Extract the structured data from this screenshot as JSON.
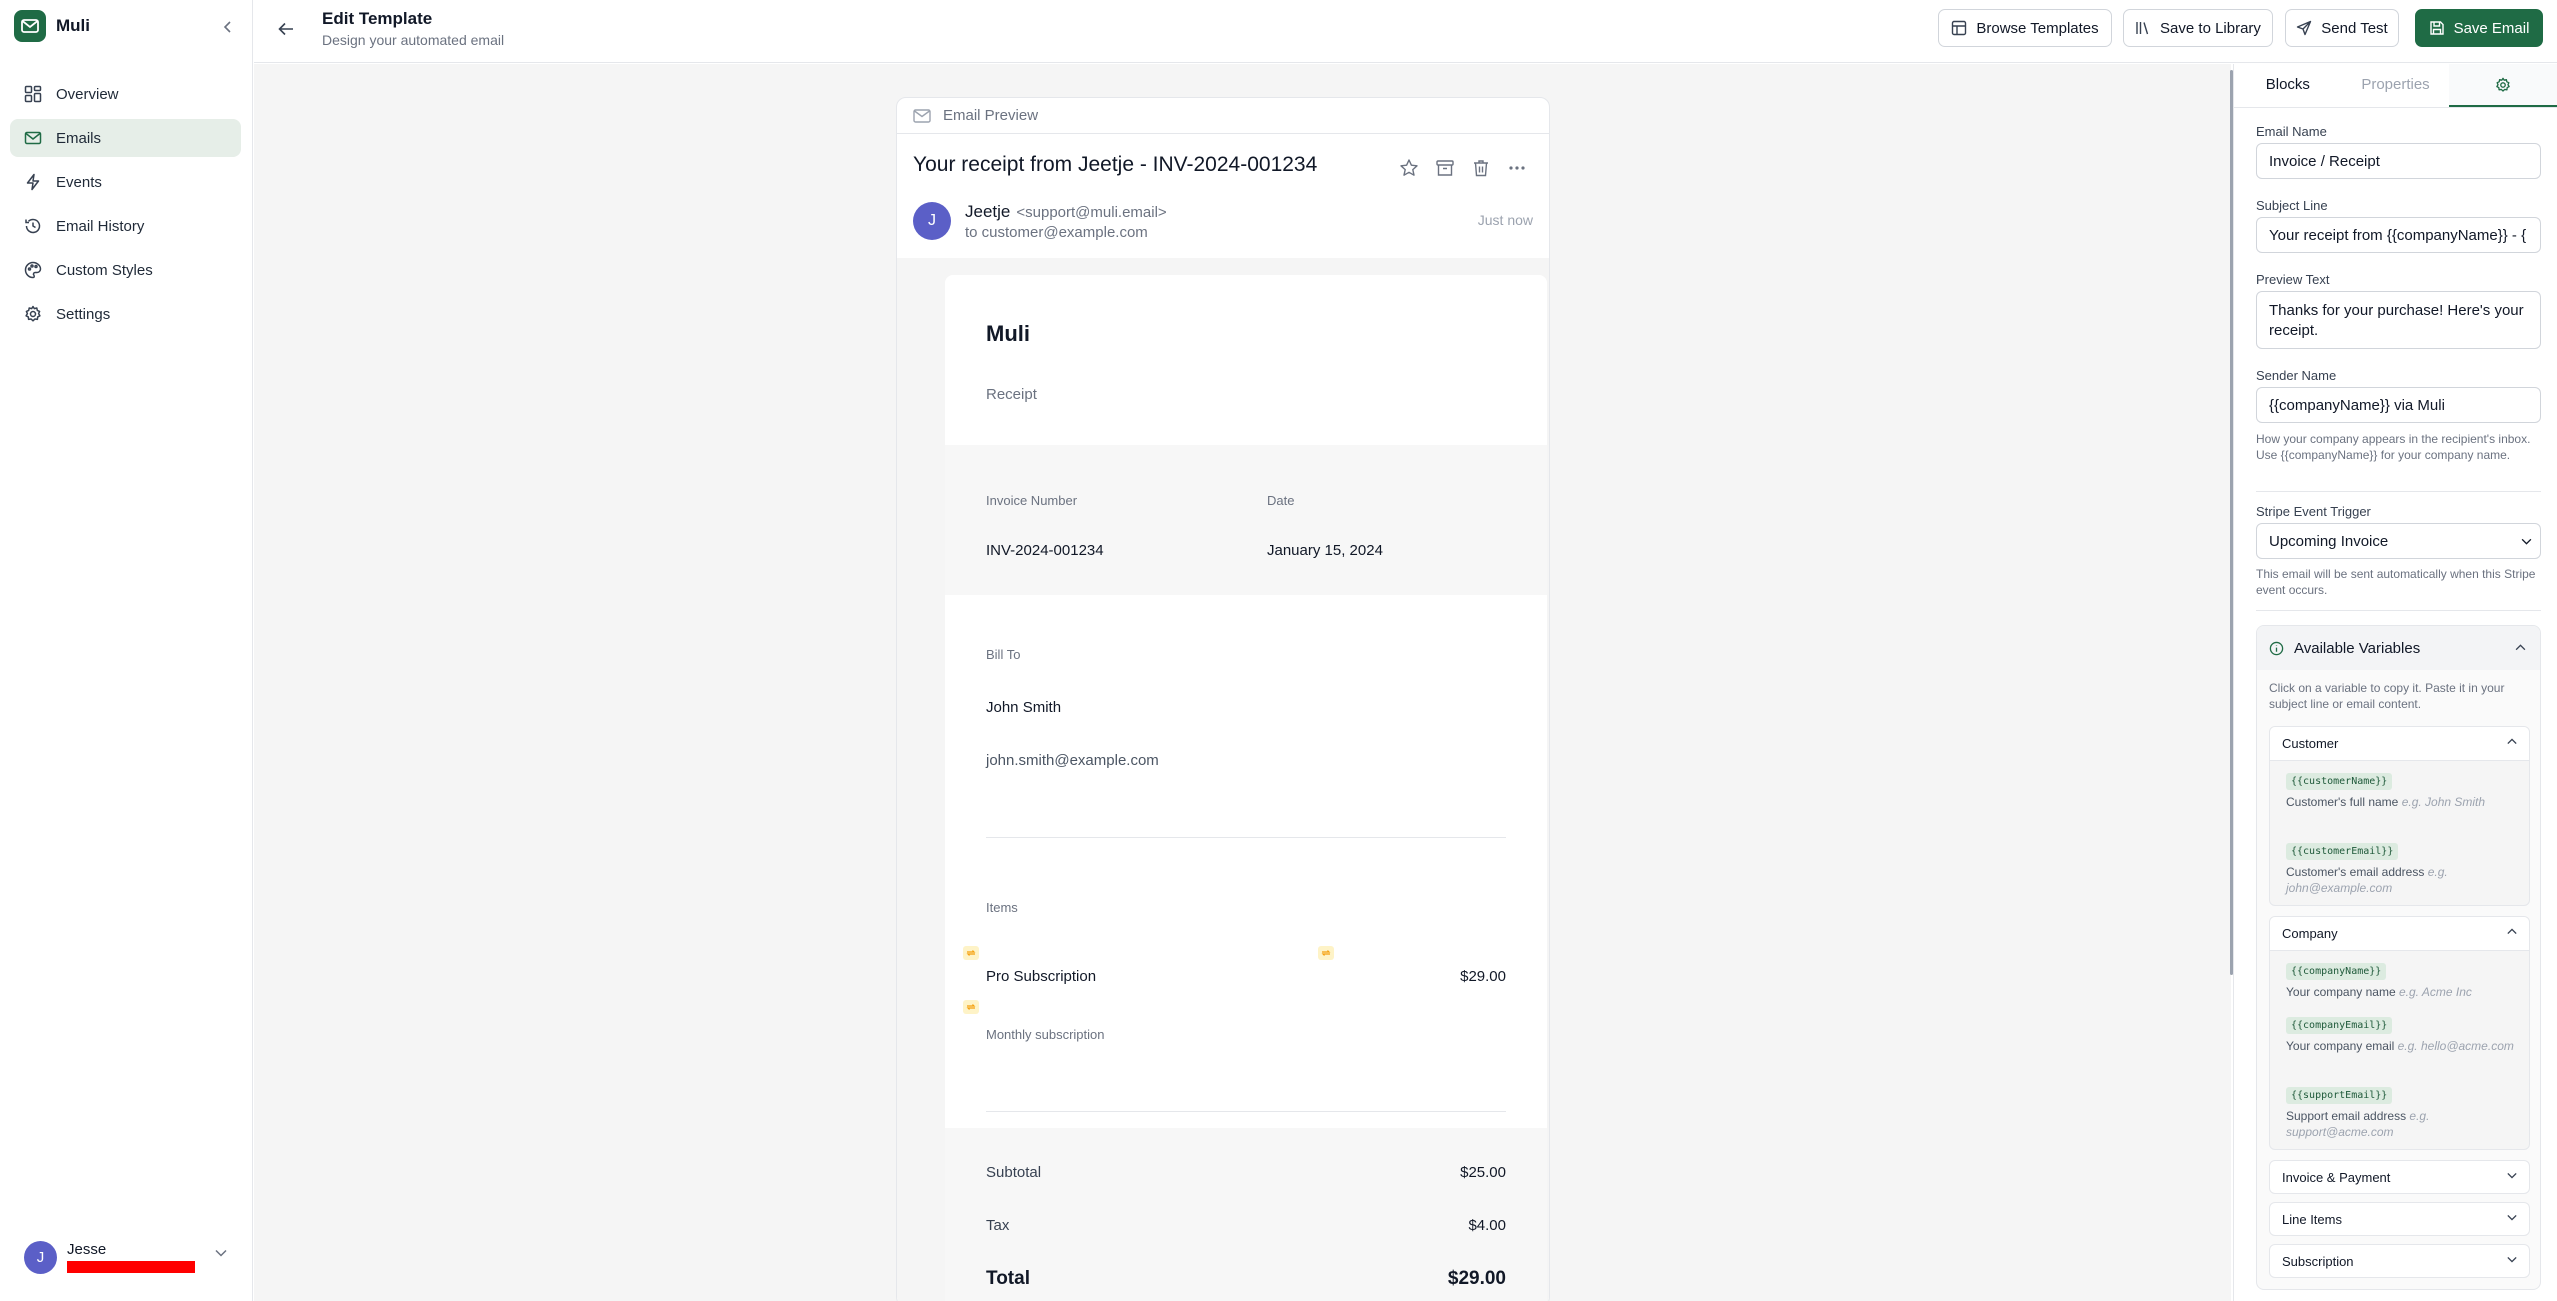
{
  "app": {
    "name": "Muli"
  },
  "sidebar": {
    "items": [
      {
        "label": "Overview",
        "icon": "grid-icon",
        "active": false
      },
      {
        "label": "Emails",
        "icon": "mail-icon",
        "active": true
      },
      {
        "label": "Events",
        "icon": "bolt-icon",
        "active": false
      },
      {
        "label": "Email History",
        "icon": "history-icon",
        "active": false
      },
      {
        "label": "Custom Styles",
        "icon": "palette-icon",
        "active": false
      },
      {
        "label": "Settings",
        "icon": "gear-icon",
        "active": false
      }
    ],
    "user": {
      "initial": "J",
      "name": "Jesse"
    }
  },
  "header": {
    "title": "Edit Template",
    "subtitle": "Design your automated email",
    "buttons": {
      "browse": "Browse Templates",
      "save_library": "Save to Library",
      "send_test": "Send Test",
      "save_email": "Save Email"
    }
  },
  "preview": {
    "bar_label": "Email Preview",
    "subject": "Your receipt from Jeetje - INV-2024-001234",
    "sender": {
      "initial": "J",
      "name": "Jeetje",
      "email": "<support@muli.email>",
      "to": "to customer@example.com",
      "time": "Just now"
    },
    "receipt": {
      "brand": "Muli",
      "label": "Receipt",
      "invoice_number_label": "Invoice Number",
      "invoice_number": "INV-2024-001234",
      "date_label": "Date",
      "date": "January 15, 2024",
      "bill_to_label": "Bill To",
      "bill_name": "John Smith",
      "bill_email": "john.smith@example.com",
      "items_label": "Items",
      "item_name": "Pro Subscription",
      "item_price": "$29.00",
      "item_desc": "Monthly subscription",
      "subtotal_label": "Subtotal",
      "subtotal": "$25.00",
      "tax_label": "Tax",
      "tax": "$4.00",
      "total_label": "Total",
      "total": "$29.00"
    }
  },
  "panel": {
    "tabs": [
      "Blocks",
      "Properties"
    ],
    "settings_tab_icon": "gear-icon",
    "fields": {
      "email_name_label": "Email Name",
      "email_name": "Invoice / Receipt",
      "subject_label": "Subject Line",
      "subject": "Your receipt from {{companyName}} - {",
      "preview_label": "Preview Text",
      "preview": "Thanks for your purchase! Here's your receipt.",
      "sender_label": "Sender Name",
      "sender": "{{companyName}} via Muli",
      "sender_help": "How your company appears in the recipient's inbox. Use {{companyName}} for your company name.",
      "trigger_label": "Stripe Event Trigger",
      "trigger": "Upcoming Invoice",
      "trigger_help": "This email will be sent automatically when this Stripe event occurs."
    },
    "variables": {
      "title": "Available Variables",
      "description": "Click on a variable to copy it. Paste it in your subject line or email content.",
      "groups": [
        {
          "name": "Customer",
          "items": [
            {
              "code": "{{customerName}}",
              "desc": "Customer's full name",
              "eg": "e.g. John Smith"
            },
            {
              "code": "{{customerEmail}}",
              "desc": "Customer's email address",
              "eg": "e.g. john@example.com"
            }
          ]
        },
        {
          "name": "Company",
          "items": [
            {
              "code": "{{companyName}}",
              "desc": "Your company name",
              "eg": "e.g. Acme Inc"
            },
            {
              "code": "{{companyEmail}}",
              "desc": "Your company email",
              "eg": "e.g. hello@acme.com"
            },
            {
              "code": "{{supportEmail}}",
              "desc": "Support email address",
              "eg": "e.g. support@acme.com"
            }
          ]
        },
        {
          "name": "Invoice & Payment",
          "items": []
        },
        {
          "name": "Line Items",
          "items": []
        },
        {
          "name": "Subscription",
          "items": []
        }
      ]
    }
  },
  "colors": {
    "brand": "#1f6b45",
    "avatar": "#5b5fc7",
    "active_nav": "#e6eee8",
    "var_chip": "#dcebe0"
  }
}
